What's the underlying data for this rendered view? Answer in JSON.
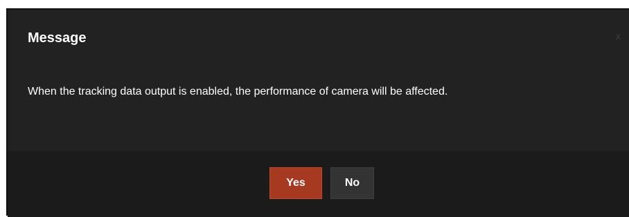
{
  "dialog": {
    "title": "Message",
    "close_label": "x",
    "message": "When the tracking data output is enabled, the performance of camera will be affected.",
    "buttons": {
      "yes_label": "Yes",
      "no_label": "No"
    }
  },
  "colors": {
    "dialog_background": "#222222",
    "footer_background": "#1b1b1b",
    "primary_button": "#a63a20",
    "secondary_button": "#333333",
    "text": "#ffffff"
  }
}
